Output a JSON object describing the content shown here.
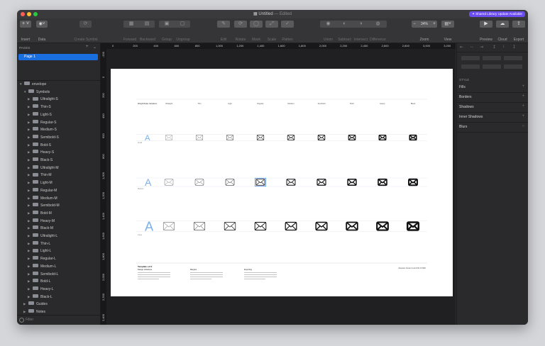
{
  "window": {
    "title": "Untitled",
    "title_status": "— Edited",
    "badge": "✦ Shared Library Update Available",
    "traffic": {
      "close": "#ff5f57",
      "minimize": "#febc2e",
      "zoom": "#28c840"
    }
  },
  "toolbar": {
    "insert": "Insert",
    "data": "Data",
    "create_symbol": "Create Symbol",
    "forward": "Forward",
    "backward": "Backward",
    "group": "Group",
    "ungroup": "Ungroup",
    "edit": "Edit",
    "rotate": "Rotate",
    "mask": "Mask",
    "scale": "Scale",
    "flatten": "Flatten",
    "union": "Union",
    "subtract": "Subtract",
    "intersect": "Intersect",
    "difference": "Difference",
    "zoom_value": "34%",
    "zoom": "Zoom",
    "view": "View",
    "preview": "Preview",
    "cloud": "Cloud",
    "export": "Export"
  },
  "sidebar": {
    "pages_header": "PAGES",
    "pages": [
      "Page 1"
    ],
    "layers": [
      {
        "label": "envelope",
        "level": 0,
        "open": true
      },
      {
        "label": "Symbols",
        "level": 1,
        "open": true
      },
      {
        "label": "Ultralight-S",
        "level": 2
      },
      {
        "label": "Thin-S",
        "level": 2
      },
      {
        "label": "Light-S",
        "level": 2
      },
      {
        "label": "Regular-S",
        "level": 2
      },
      {
        "label": "Medium-S",
        "level": 2
      },
      {
        "label": "Semibold-S",
        "level": 2
      },
      {
        "label": "Bold-S",
        "level": 2
      },
      {
        "label": "Heavy-S",
        "level": 2
      },
      {
        "label": "Black-S",
        "level": 2
      },
      {
        "label": "Ultralight-M",
        "level": 2
      },
      {
        "label": "Thin-M",
        "level": 2
      },
      {
        "label": "Light-M",
        "level": 2
      },
      {
        "label": "Regular-M",
        "level": 2
      },
      {
        "label": "Medium-M",
        "level": 2
      },
      {
        "label": "Semibold-M",
        "level": 2
      },
      {
        "label": "Bold-M",
        "level": 2
      },
      {
        "label": "Heavy-M",
        "level": 2
      },
      {
        "label": "Black-M",
        "level": 2
      },
      {
        "label": "Ultralight-L",
        "level": 2
      },
      {
        "label": "Thin-L",
        "level": 2
      },
      {
        "label": "Light-L",
        "level": 2
      },
      {
        "label": "Regular-L",
        "level": 2
      },
      {
        "label": "Medium-L",
        "level": 2
      },
      {
        "label": "Semibold-L",
        "level": 2
      },
      {
        "label": "Bold-L",
        "level": 2
      },
      {
        "label": "Heavy-L",
        "level": 2
      },
      {
        "label": "Black-L",
        "level": 2
      },
      {
        "label": "Guides",
        "level": 1
      },
      {
        "label": "Notes",
        "level": 1
      }
    ],
    "filter_placeholder": "Filter"
  },
  "rulers": {
    "horizontal": [
      "0",
      "200",
      "400",
      "600",
      "800",
      "1,000",
      "1,200",
      "1,400",
      "1,600",
      "1,800",
      "2,000",
      "2,200",
      "2,400",
      "2,600",
      "2,800",
      "3,000",
      "3,200"
    ],
    "vertical": [
      "-200",
      "0",
      "200",
      "400",
      "600",
      "800",
      "1,000",
      "1,200",
      "1,400",
      "1,600",
      "1,800",
      "2,000",
      "2,200",
      "2,400"
    ]
  },
  "inspector": {
    "style_header": "STYLE",
    "sections": [
      "Fills",
      "Borders",
      "Shadows",
      "Inner Shadows",
      "Blurs"
    ]
  },
  "artboard": {
    "header_label": "Weight/Scale Variations",
    "columns": [
      "Ultralight",
      "Thin",
      "Light",
      "Regular",
      "Medium",
      "Semibold",
      "Bold",
      "Heavy",
      "Black"
    ],
    "rows": [
      {
        "label": "Small",
        "scale": 0.8
      },
      {
        "label": "Medium",
        "scale": 1.0
      },
      {
        "label": "Large",
        "scale": 1.3
      }
    ],
    "weights": [
      0.6,
      0.8,
      1.1,
      1.5,
      1.9,
      2.3,
      2.8,
      3.3,
      3.8
    ],
    "footer": {
      "version_label": "Template v.2.0",
      "col1_head": "Design Variations",
      "col2_head": "Margins",
      "col3_head": "Exporting",
      "right_note": "Requires Xcode 11 and iOS 13 SDK"
    }
  },
  "accent": "#1a6fe0"
}
